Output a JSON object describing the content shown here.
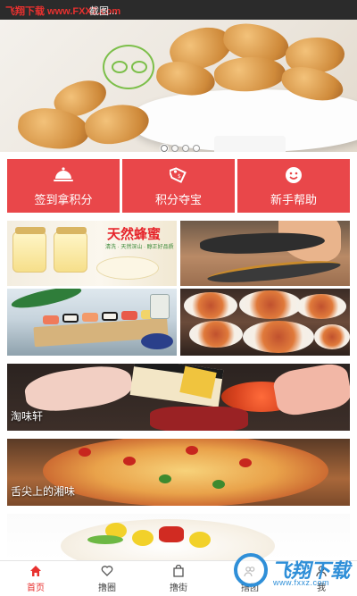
{
  "status_bar": {
    "watermark": "飞翔下载 www.FXXZ.com",
    "screen_text": "截图..."
  },
  "banner": {
    "slide_count": 4,
    "active_slide": 1
  },
  "actions": [
    {
      "label": "签到拿积分",
      "icon": "cloche-icon"
    },
    {
      "label": "积分夺宝",
      "icon": "price-tag-icon"
    },
    {
      "label": "新手帮助",
      "icon": "smiley-icon"
    }
  ],
  "tiles": {
    "honey": {
      "title": "天然蜂蜜",
      "sub": "清洗 · 天然深山 · 醇正好品质"
    },
    "restaurant_1": {
      "caption": "淘味轩"
    },
    "restaurant_2": {
      "caption": "舌尖上的湘味"
    }
  },
  "tabbar": [
    {
      "label": "首页",
      "icon": "home-icon",
      "active": true
    },
    {
      "label": "撸圈",
      "icon": "heart-icon",
      "active": false
    },
    {
      "label": "撸街",
      "icon": "shopping-bag-icon",
      "active": false
    },
    {
      "label": "撸团",
      "icon": "group-icon",
      "active": false
    },
    {
      "label": "我",
      "icon": "user-icon",
      "active": false
    }
  ],
  "watermark_bottom": {
    "brand": "飞翔下载",
    "url": "www.fxxz.com"
  },
  "colors": {
    "accent": "#e9474a",
    "tab_active": "#e8312f",
    "watermark_blue": "#2f8fd8"
  }
}
